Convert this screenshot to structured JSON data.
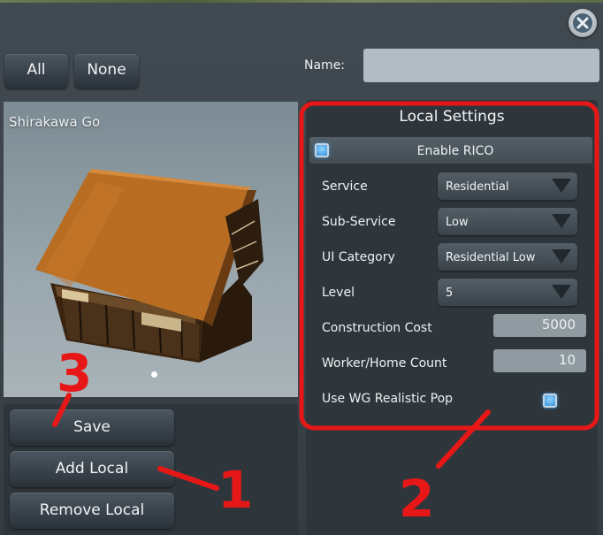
{
  "toolbar": {
    "all_label": "All",
    "none_label": "None"
  },
  "name_field": {
    "label": "Name:",
    "value": ""
  },
  "preview": {
    "title": "Shirakawa Go"
  },
  "actions": {
    "save_label": "Save",
    "add_local_label": "Add Local",
    "remove_local_label": "Remove Local"
  },
  "settings": {
    "title": "Local Settings",
    "enable_rico_label": "Enable RICO",
    "enable_rico_checked": true,
    "service_label": "Service",
    "service_value": "Residential",
    "subservice_label": "Sub-Service",
    "subservice_value": "Low",
    "ui_category_label": "UI Category",
    "ui_category_value": "Residential Low",
    "level_label": "Level",
    "level_value": "5",
    "construction_cost_label": "Construction Cost",
    "construction_cost_value": "5000",
    "worker_home_label": "Worker/Home Count",
    "worker_home_value": "10",
    "wg_pop_label": "Use WG Realistic Pop",
    "wg_pop_checked": true
  },
  "annotations": {
    "one": "1",
    "two": "2",
    "three": "3",
    "color": "#e81717"
  },
  "icons": {
    "close": "close-icon",
    "dropdown": "chevron-down-icon"
  }
}
